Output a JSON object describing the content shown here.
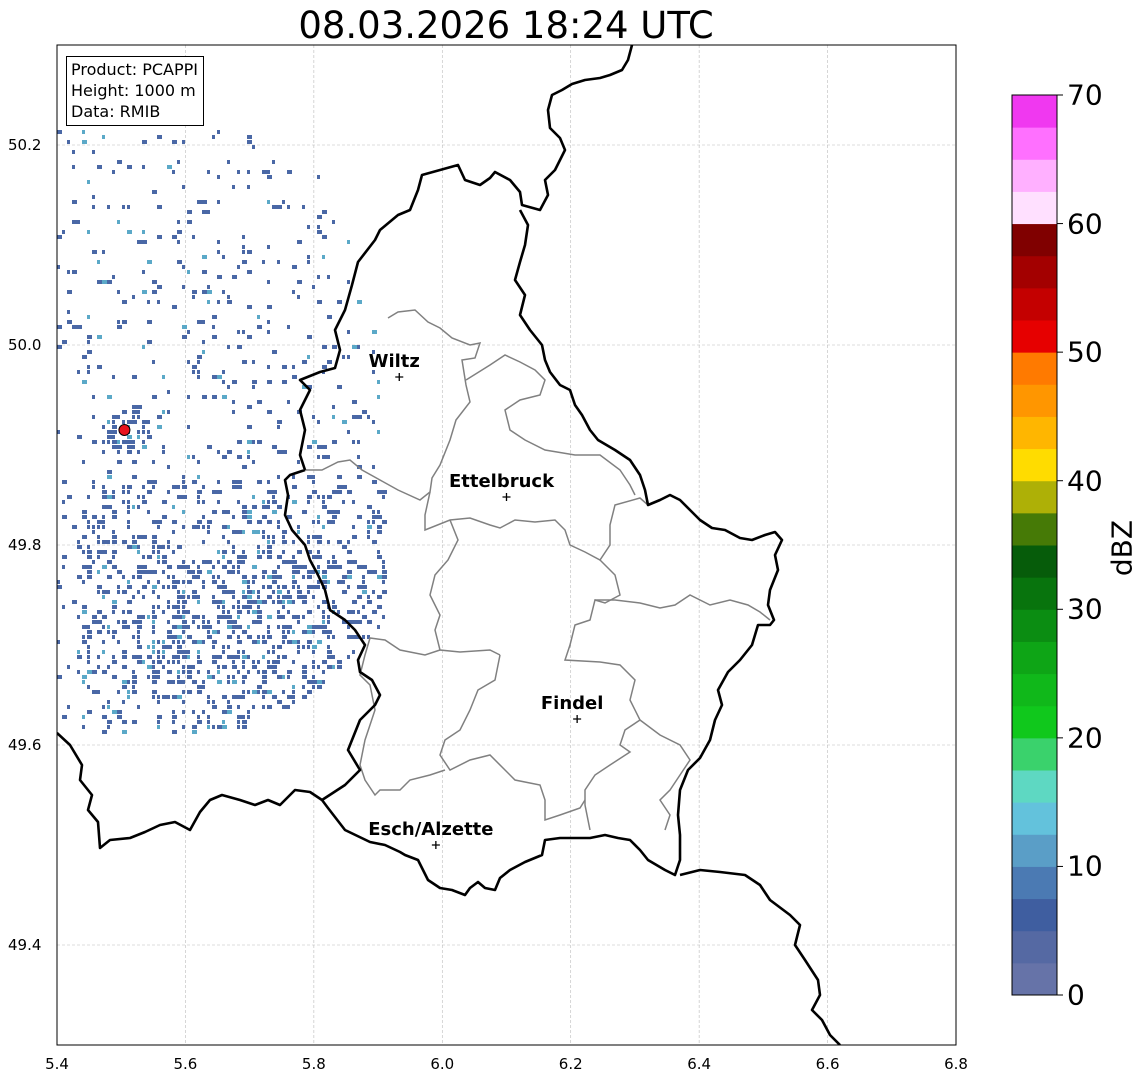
{
  "title": "08.03.2026 18:24 UTC",
  "info": {
    "product": "Product: PCAPPI",
    "height": "Height: 1000 m",
    "data": "Data: RMIB"
  },
  "axes": {
    "x_ticks": [
      "5.4",
      "5.6",
      "5.8",
      "6.0",
      "6.2",
      "6.4",
      "6.6",
      "6.8"
    ],
    "y_ticks": [
      "50.2",
      "50.0",
      "49.8",
      "49.6",
      "49.4"
    ],
    "xlim": [
      5.4,
      6.8
    ],
    "ylim": [
      49.3,
      50.3
    ],
    "grid": true
  },
  "colorbar": {
    "label": "dBZ",
    "ticks": [
      "0",
      "10",
      "20",
      "30",
      "40",
      "50",
      "60",
      "70"
    ],
    "range": [
      0,
      70
    ],
    "colors": [
      "#6673a8",
      "#5569a3",
      "#3f5ea0",
      "#4b7ab3",
      "#5a9ec7",
      "#63c2dc",
      "#5ed8c2",
      "#3ad26c",
      "#10c81c",
      "#10b81a",
      "#0ea516",
      "#0b8d12",
      "#08740d",
      "#065c0a",
      "#467a06",
      "#aeb006",
      "#ffdc00",
      "#ffb600",
      "#ff9600",
      "#ff7a00",
      "#e60000",
      "#c40000",
      "#a30000",
      "#800000",
      "#ffe0ff",
      "#ffb0ff",
      "#ff70ff",
      "#f038f0"
    ]
  },
  "cities": [
    {
      "name": "Wiltz",
      "lon": 5.933,
      "lat": 49.968
    },
    {
      "name": "Ettelbruck",
      "lon": 6.1,
      "lat": 49.848
    },
    {
      "name": "Findel",
      "lon": 6.21,
      "lat": 49.626
    },
    {
      "name": "Esch/Alzette",
      "lon": 5.99,
      "lat": 49.5
    }
  ],
  "radar_site": {
    "lon": 5.505,
    "lat": 49.915
  },
  "colors": {
    "border": "#000000",
    "cantons": "#808080",
    "grid": "#bbbbbb",
    "radar_site": "#e8141e",
    "echo_main": "#4a68a6",
    "echo_secondary": "#5ba9c8"
  }
}
